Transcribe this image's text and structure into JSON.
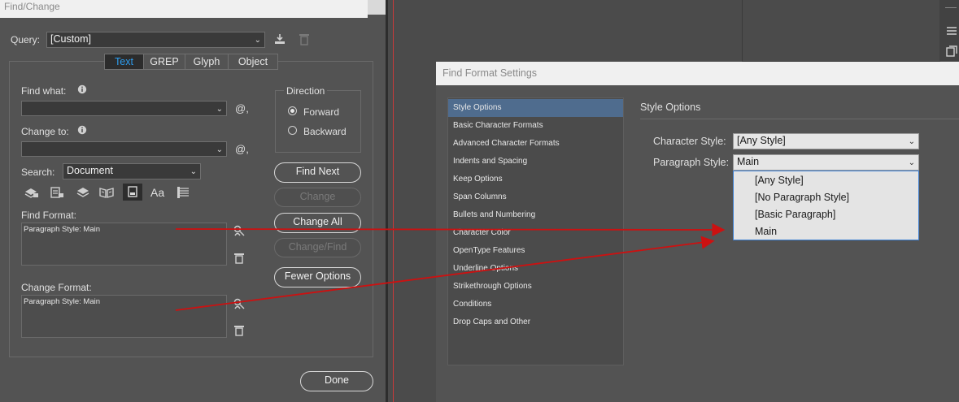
{
  "find_change": {
    "title": "Find/Change",
    "query_label": "Query:",
    "query_value": "[Custom]",
    "tabs": [
      "Text",
      "GREP",
      "Glyph",
      "Object"
    ],
    "active_tab": "Text",
    "find_what_label": "Find what:",
    "find_what_value": "",
    "change_to_label": "Change to:",
    "change_to_value": "",
    "special_char_symbol": "@,",
    "search_label": "Search:",
    "search_value": "Document",
    "direction_label": "Direction",
    "direction_options": [
      "Forward",
      "Backward"
    ],
    "direction_selected": "Forward",
    "buttons": {
      "find_next": "Find Next",
      "change": "Change",
      "change_all": "Change All",
      "change_find": "Change/Find",
      "fewer_options": "Fewer Options",
      "done": "Done"
    },
    "find_format_label": "Find Format:",
    "find_format_value": "Paragraph Style: Main",
    "change_format_label": "Change Format:",
    "change_format_value": "Paragraph Style: Main",
    "icons": {
      "info": "info-icon",
      "save_query": "save-query-icon",
      "delete_query": "trash-icon",
      "search_options": [
        "locked-layers-icon",
        "locked-stories-icon",
        "hidden-layers-icon",
        "master-pages-icon",
        "footnotes-icon",
        "case-sensitive-icon",
        "whole-word-icon"
      ],
      "specify_attributes": "specify-attributes-icon",
      "clear_attributes": "trash-icon"
    }
  },
  "find_format_settings": {
    "title": "Find Format Settings",
    "categories": [
      "Style Options",
      "Basic Character Formats",
      "Advanced Character Formats",
      "Indents and Spacing",
      "Keep Options",
      "Span Columns",
      "Bullets and Numbering",
      "Character Color",
      "OpenType Features",
      "Underline Options",
      "Strikethrough Options",
      "Conditions",
      "Drop Caps and Other"
    ],
    "selected_category": "Style Options",
    "section_title": "Style Options",
    "character_style_label": "Character Style:",
    "character_style_value": "[Any Style]",
    "paragraph_style_label": "Paragraph Style:",
    "paragraph_style_value": "Main",
    "paragraph_style_options": [
      "[Any Style]",
      "[No Paragraph Style]",
      "[Basic Paragraph]",
      "Main"
    ]
  },
  "annotation": {
    "arrow_color": "#cc1111"
  },
  "colors": {
    "panel_bg": "#535353",
    "title_bar_bg": "#f0f0f0",
    "active_tab_text": "#2d9df0",
    "selected_list_bg": "#4f6c8e",
    "dropdown_border": "#3b7fd4"
  }
}
